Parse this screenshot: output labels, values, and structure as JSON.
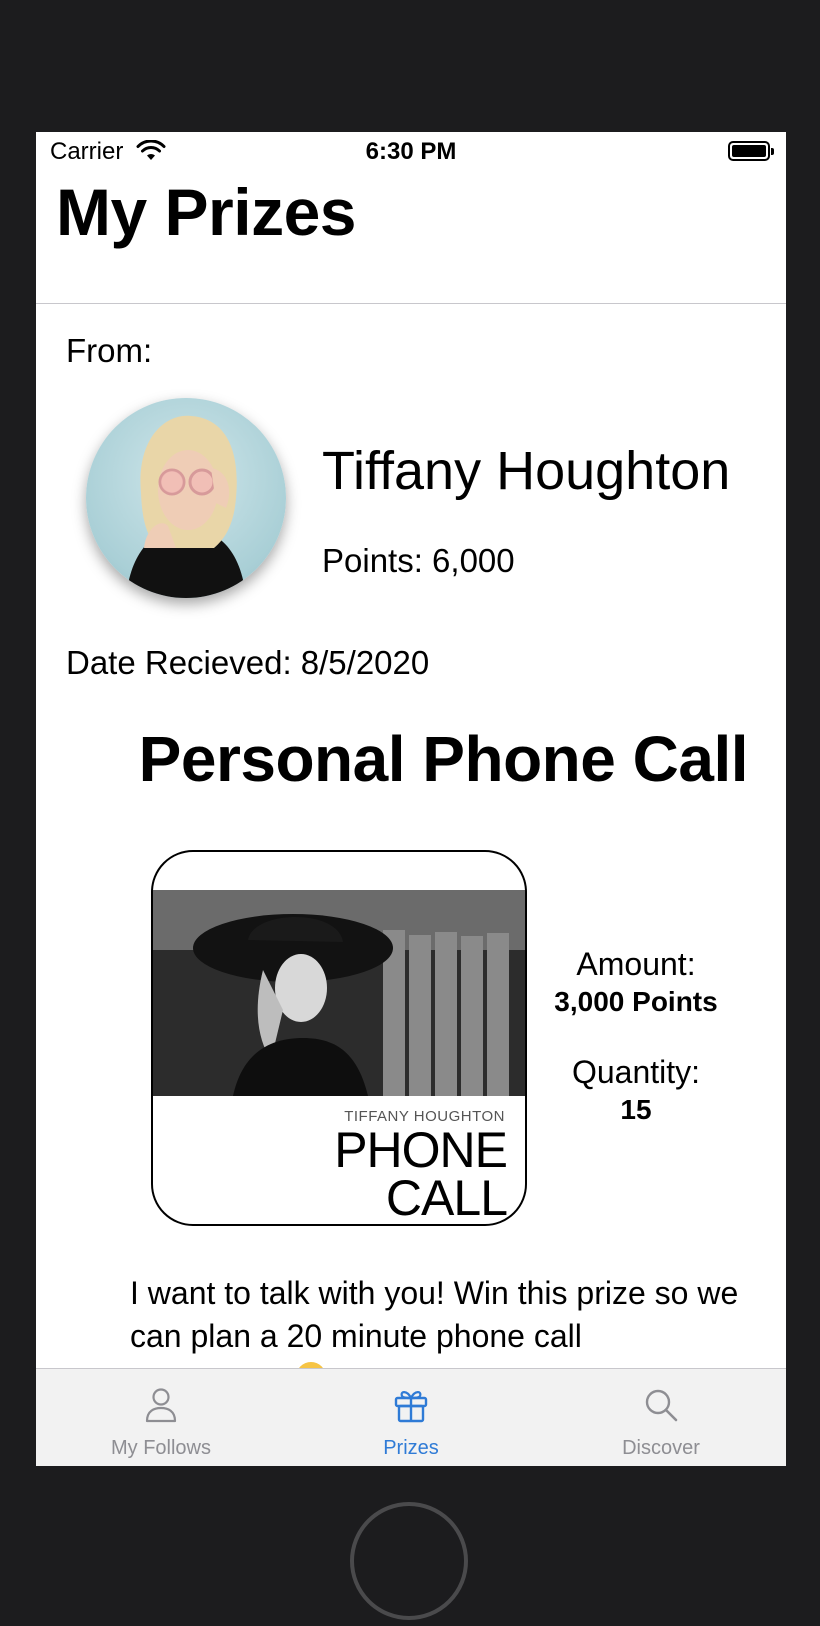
{
  "status_bar": {
    "carrier": "Carrier",
    "time": "6:30 PM"
  },
  "nav": {
    "title": "My Prizes"
  },
  "prize": {
    "from_label": "From:",
    "creator_name": "Tiffany Houghton",
    "creator_points": "Points: 6,000",
    "date_received": "Date Recieved: 8/5/2020",
    "title": "Personal Phone Call",
    "card": {
      "caption": "TIFFANY HOUGHTON",
      "line1": "PHONE",
      "line2": "CALL"
    },
    "amount_label": "Amount:",
    "amount_value": "3,000 Points",
    "quantity_label": "Quantity:",
    "quantity_value": "15",
    "description": "I want to talk with you! Win this prize so we can plan a 20 minute phone call"
  },
  "tab_bar": {
    "tabs": [
      {
        "label": "My Follows",
        "icon": "person-icon",
        "selected": false
      },
      {
        "label": "Prizes",
        "icon": "gift-icon",
        "selected": true
      },
      {
        "label": "Discover",
        "icon": "search-icon",
        "selected": false
      }
    ],
    "active_color": "#2f7bd6",
    "inactive_color": "#8e8e93"
  }
}
